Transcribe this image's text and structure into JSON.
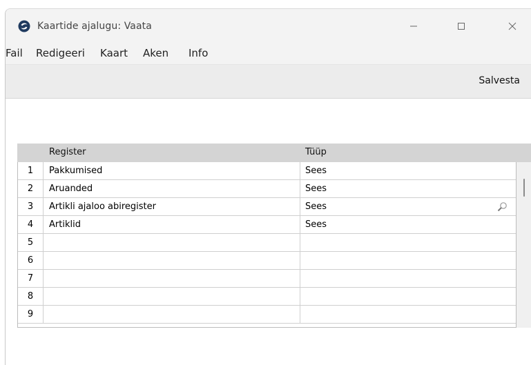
{
  "window": {
    "title": "Kaartide ajalugu: Vaata",
    "controls": {
      "minimize": "—",
      "maximize": "☐",
      "close": "✕"
    }
  },
  "menu": {
    "items": [
      "Fail",
      "Redigeeri",
      "Kaart",
      "Aken",
      "Info"
    ]
  },
  "toolbar": {
    "save_label": "Salvesta"
  },
  "grid": {
    "columns": {
      "register": "Register",
      "type": "Tüüp"
    },
    "rows": [
      {
        "num": "1",
        "register": "Pakkumised",
        "type": "Sees"
      },
      {
        "num": "2",
        "register": "Aruanded",
        "type": "Sees"
      },
      {
        "num": "3",
        "register": "Artikli ajaloo abiregister",
        "type": "Sees"
      },
      {
        "num": "4",
        "register": "Artiklid",
        "type": "Sees"
      },
      {
        "num": "5",
        "register": "",
        "type": ""
      },
      {
        "num": "6",
        "register": "",
        "type": ""
      },
      {
        "num": "7",
        "register": "",
        "type": ""
      },
      {
        "num": "8",
        "register": "",
        "type": ""
      },
      {
        "num": "9",
        "register": "",
        "type": ""
      }
    ]
  },
  "icons": {
    "app": "app-logo-icon",
    "lookup": "magnifier-icon"
  },
  "colors": {
    "titlebar_bg": "#f3f3f3",
    "toolbar_bg": "#ececec",
    "header_bg": "#d4d4d4",
    "grid_border": "#bcbcbc"
  }
}
